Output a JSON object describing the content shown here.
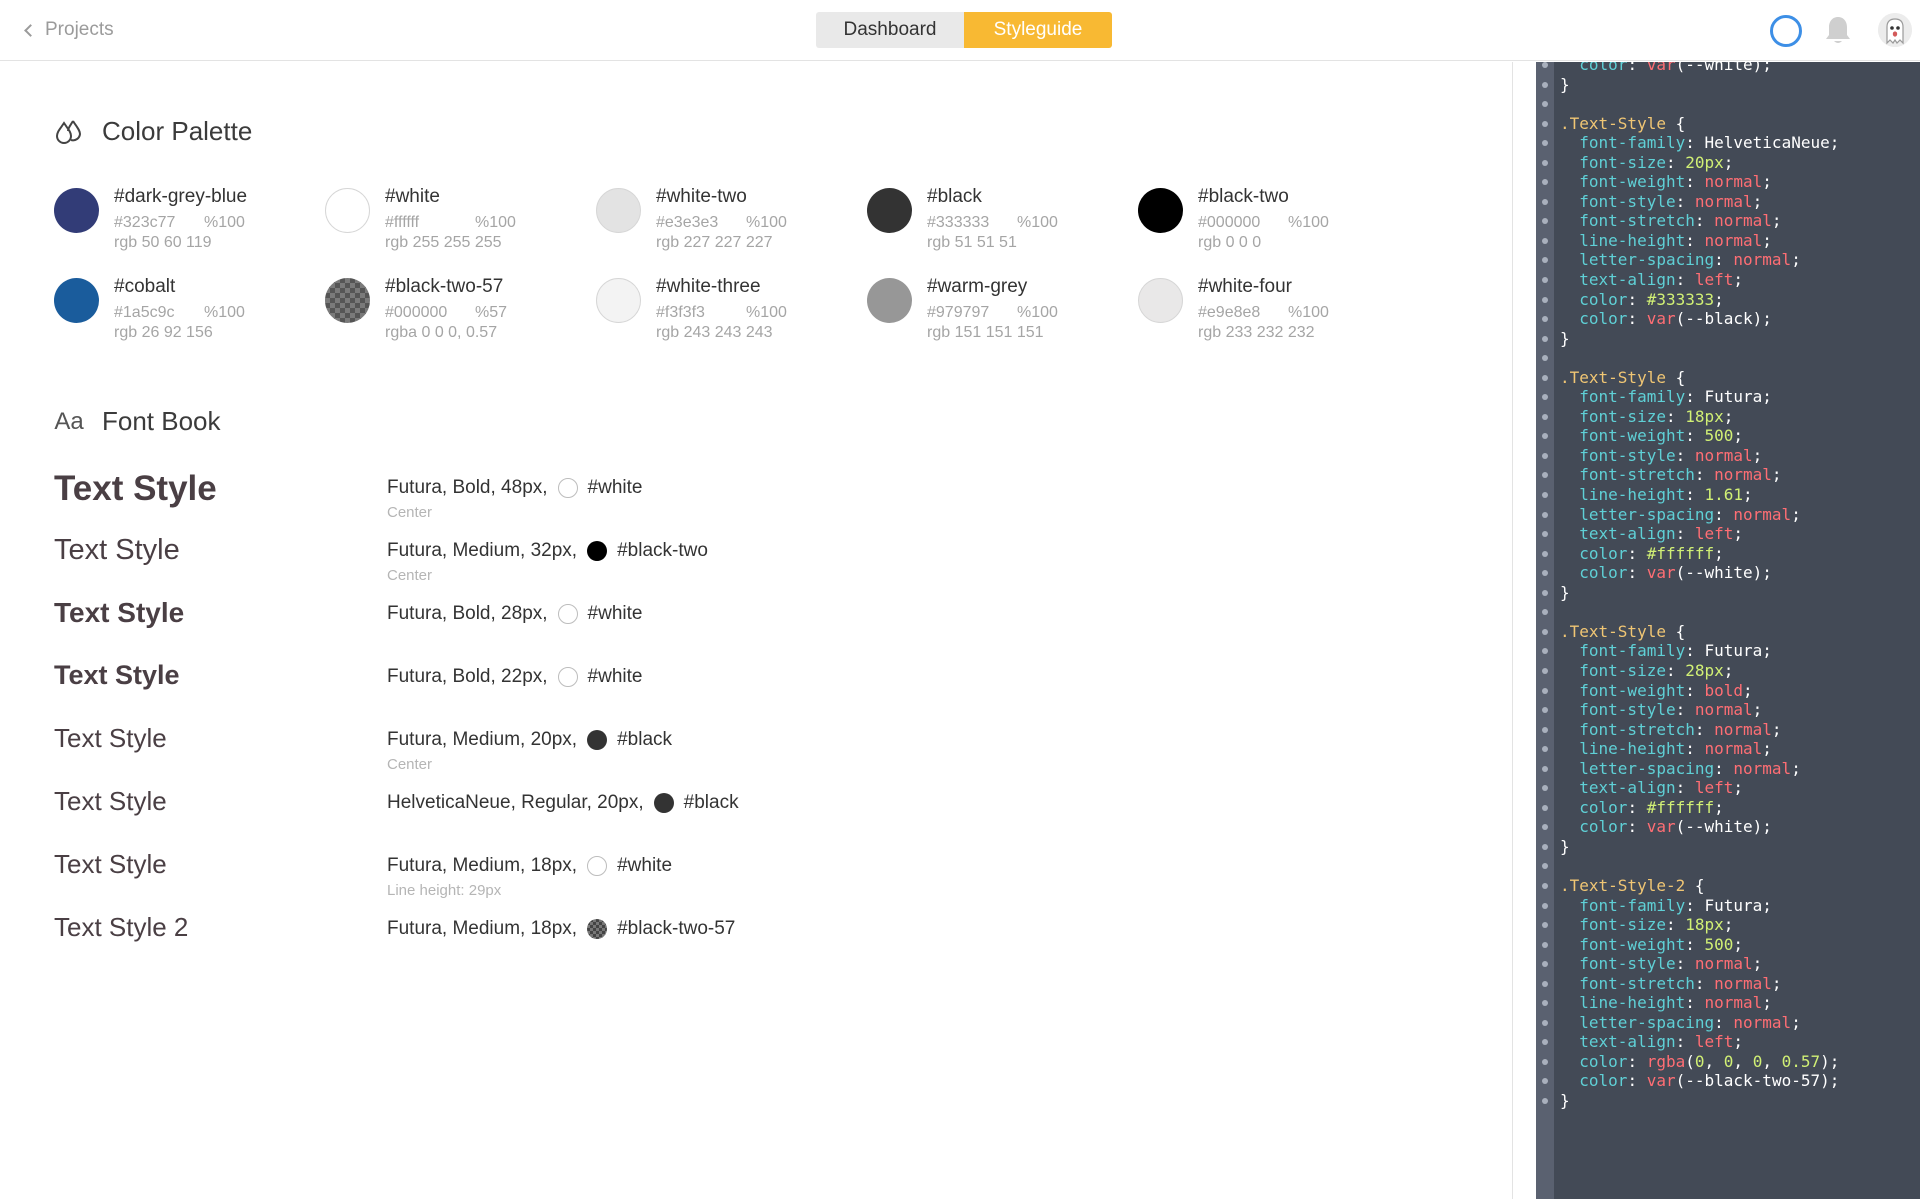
{
  "topbar": {
    "back_label": "Projects",
    "tabs": [
      {
        "label": "Dashboard",
        "active": false
      },
      {
        "label": "Styleguide",
        "active": true
      }
    ],
    "accent_color": "#f8b933",
    "status_color": "#3d8fe6"
  },
  "palette": {
    "title": "Color Palette",
    "colors": [
      {
        "name": "#dark-grey-blue",
        "hex": "#323c77",
        "opacity": "%100",
        "rgb": "rgb 50 60 119",
        "color": "#323c77"
      },
      {
        "name": "#white",
        "hex": "#ffffff",
        "opacity": "%100",
        "rgb": "rgb 255 255 255",
        "color": "#ffffff"
      },
      {
        "name": "#white-two",
        "hex": "#e3e3e3",
        "opacity": "%100",
        "rgb": "rgb 227 227 227",
        "color": "#e3e3e3"
      },
      {
        "name": "#black",
        "hex": "#333333",
        "opacity": "%100",
        "rgb": "rgb 51 51 51",
        "color": "#333333"
      },
      {
        "name": "#black-two",
        "hex": "#000000",
        "opacity": "%100",
        "rgb": "rgb 0 0 0",
        "color": "#000000"
      },
      {
        "name": "#cobalt",
        "hex": "#1a5c9c",
        "opacity": "%100",
        "rgb": "rgb 26 92 156",
        "color": "#1a5c9c"
      },
      {
        "name": "#black-two-57",
        "hex": "#000000",
        "opacity": "%57",
        "rgb": "rgba 0 0 0, 0.57",
        "color": "#6d6d6d"
      },
      {
        "name": "#white-three",
        "hex": "#f3f3f3",
        "opacity": "%100",
        "rgb": "rgb 243 243 243",
        "color": "#f3f3f3"
      },
      {
        "name": "#warm-grey",
        "hex": "#979797",
        "opacity": "%100",
        "rgb": "rgb 151 151 151",
        "color": "#979797"
      },
      {
        "name": "#white-four",
        "hex": "#e9e8e8",
        "opacity": "%100",
        "rgb": "rgb 233 232 232",
        "color": "#e9e8e8"
      }
    ]
  },
  "fontbook": {
    "title": "Font Book",
    "icon_text": "Aa",
    "styles": [
      {
        "sample": "Text Style",
        "desc": "Futura, Bold, 48px,",
        "color_name": "#white",
        "color": "#ffffff",
        "sub": "Center"
      },
      {
        "sample": "Text Style",
        "desc": "Futura, Medium, 32px,",
        "color_name": "#black-two",
        "color": "#000000",
        "sub": "Center"
      },
      {
        "sample": "Text Style",
        "desc": "Futura, Bold, 28px,",
        "color_name": "#white",
        "color": "#ffffff",
        "sub": ""
      },
      {
        "sample": "Text Style",
        "desc": "Futura, Bold, 22px,",
        "color_name": "#white",
        "color": "#ffffff",
        "sub": ""
      },
      {
        "sample": "Text Style",
        "desc": "Futura, Medium, 20px,",
        "color_name": "#black",
        "color": "#333333",
        "sub": "Center"
      },
      {
        "sample": "Text Style",
        "desc": "HelveticaNeue, Regular, 20px,",
        "color_name": "#black",
        "color": "#333333",
        "sub": ""
      },
      {
        "sample": "Text Style",
        "desc": "Futura, Medium, 18px,",
        "color_name": "#white",
        "color": "#ffffff",
        "sub": "Line height: 29px"
      },
      {
        "sample": "Text Style 2",
        "desc": "Futura, Medium, 18px,",
        "color_name": "#black-two-57",
        "color": "#6d6d6d",
        "sub": ""
      }
    ]
  },
  "code_lines": [
    [
      [
        "  ",
        "pun"
      ],
      [
        "color",
        "prop"
      ],
      [
        ": ",
        "pun"
      ],
      [
        "var",
        "fn"
      ],
      [
        "(--white);",
        "pun"
      ]
    ],
    [
      [
        "}",
        "pun"
      ]
    ],
    [
      [
        "",
        "pun"
      ]
    ],
    [
      [
        ".Text-Style",
        "sel"
      ],
      [
        " {",
        "pun"
      ]
    ],
    [
      [
        "  ",
        "pun"
      ],
      [
        "font-family",
        "prop"
      ],
      [
        ": HelveticaNeue;",
        "pun"
      ]
    ],
    [
      [
        "  ",
        "pun"
      ],
      [
        "font-size",
        "prop"
      ],
      [
        ": ",
        "pun"
      ],
      [
        "20px",
        "num"
      ],
      [
        ";",
        "pun"
      ]
    ],
    [
      [
        "  ",
        "pun"
      ],
      [
        "font-weight",
        "prop"
      ],
      [
        ": ",
        "pun"
      ],
      [
        "normal",
        "kw"
      ],
      [
        ";",
        "pun"
      ]
    ],
    [
      [
        "  ",
        "pun"
      ],
      [
        "font-style",
        "prop"
      ],
      [
        ": ",
        "pun"
      ],
      [
        "normal",
        "kw"
      ],
      [
        ";",
        "pun"
      ]
    ],
    [
      [
        "  ",
        "pun"
      ],
      [
        "font-stretch",
        "prop"
      ],
      [
        ": ",
        "pun"
      ],
      [
        "normal",
        "kw"
      ],
      [
        ";",
        "pun"
      ]
    ],
    [
      [
        "  ",
        "pun"
      ],
      [
        "line-height",
        "prop"
      ],
      [
        ": ",
        "pun"
      ],
      [
        "normal",
        "kw"
      ],
      [
        ";",
        "pun"
      ]
    ],
    [
      [
        "  ",
        "pun"
      ],
      [
        "letter-spacing",
        "prop"
      ],
      [
        ": ",
        "pun"
      ],
      [
        "normal",
        "kw"
      ],
      [
        ";",
        "pun"
      ]
    ],
    [
      [
        "  ",
        "pun"
      ],
      [
        "text-align",
        "prop"
      ],
      [
        ": ",
        "pun"
      ],
      [
        "left",
        "kw"
      ],
      [
        ";",
        "pun"
      ]
    ],
    [
      [
        "  ",
        "pun"
      ],
      [
        "color",
        "prop"
      ],
      [
        ": ",
        "pun"
      ],
      [
        "#333333",
        "num"
      ],
      [
        ";",
        "pun"
      ]
    ],
    [
      [
        "  ",
        "pun"
      ],
      [
        "color",
        "prop"
      ],
      [
        ": ",
        "pun"
      ],
      [
        "var",
        "fn"
      ],
      [
        "(--black);",
        "pun"
      ]
    ],
    [
      [
        "}",
        "pun"
      ]
    ],
    [
      [
        "",
        "pun"
      ]
    ],
    [
      [
        ".Text-Style",
        "sel"
      ],
      [
        " {",
        "pun"
      ]
    ],
    [
      [
        "  ",
        "pun"
      ],
      [
        "font-family",
        "prop"
      ],
      [
        ": Futura;",
        "pun"
      ]
    ],
    [
      [
        "  ",
        "pun"
      ],
      [
        "font-size",
        "prop"
      ],
      [
        ": ",
        "pun"
      ],
      [
        "18px",
        "num"
      ],
      [
        ";",
        "pun"
      ]
    ],
    [
      [
        "  ",
        "pun"
      ],
      [
        "font-weight",
        "prop"
      ],
      [
        ": ",
        "pun"
      ],
      [
        "500",
        "num"
      ],
      [
        ";",
        "pun"
      ]
    ],
    [
      [
        "  ",
        "pun"
      ],
      [
        "font-style",
        "prop"
      ],
      [
        ": ",
        "pun"
      ],
      [
        "normal",
        "kw"
      ],
      [
        ";",
        "pun"
      ]
    ],
    [
      [
        "  ",
        "pun"
      ],
      [
        "font-stretch",
        "prop"
      ],
      [
        ": ",
        "pun"
      ],
      [
        "normal",
        "kw"
      ],
      [
        ";",
        "pun"
      ]
    ],
    [
      [
        "  ",
        "pun"
      ],
      [
        "line-height",
        "prop"
      ],
      [
        ": ",
        "pun"
      ],
      [
        "1.61",
        "num"
      ],
      [
        ";",
        "pun"
      ]
    ],
    [
      [
        "  ",
        "pun"
      ],
      [
        "letter-spacing",
        "prop"
      ],
      [
        ": ",
        "pun"
      ],
      [
        "normal",
        "kw"
      ],
      [
        ";",
        "pun"
      ]
    ],
    [
      [
        "  ",
        "pun"
      ],
      [
        "text-align",
        "prop"
      ],
      [
        ": ",
        "pun"
      ],
      [
        "left",
        "kw"
      ],
      [
        ";",
        "pun"
      ]
    ],
    [
      [
        "  ",
        "pun"
      ],
      [
        "color",
        "prop"
      ],
      [
        ": ",
        "pun"
      ],
      [
        "#ffffff",
        "num"
      ],
      [
        ";",
        "pun"
      ]
    ],
    [
      [
        "  ",
        "pun"
      ],
      [
        "color",
        "prop"
      ],
      [
        ": ",
        "pun"
      ],
      [
        "var",
        "fn"
      ],
      [
        "(--white);",
        "pun"
      ]
    ],
    [
      [
        "}",
        "pun"
      ]
    ],
    [
      [
        "",
        "pun"
      ]
    ],
    [
      [
        ".Text-Style",
        "sel"
      ],
      [
        " {",
        "pun"
      ]
    ],
    [
      [
        "  ",
        "pun"
      ],
      [
        "font-family",
        "prop"
      ],
      [
        ": Futura;",
        "pun"
      ]
    ],
    [
      [
        "  ",
        "pun"
      ],
      [
        "font-size",
        "prop"
      ],
      [
        ": ",
        "pun"
      ],
      [
        "28px",
        "num"
      ],
      [
        ";",
        "pun"
      ]
    ],
    [
      [
        "  ",
        "pun"
      ],
      [
        "font-weight",
        "prop"
      ],
      [
        ": ",
        "pun"
      ],
      [
        "bold",
        "kw"
      ],
      [
        ";",
        "pun"
      ]
    ],
    [
      [
        "  ",
        "pun"
      ],
      [
        "font-style",
        "prop"
      ],
      [
        ": ",
        "pun"
      ],
      [
        "normal",
        "kw"
      ],
      [
        ";",
        "pun"
      ]
    ],
    [
      [
        "  ",
        "pun"
      ],
      [
        "font-stretch",
        "prop"
      ],
      [
        ": ",
        "pun"
      ],
      [
        "normal",
        "kw"
      ],
      [
        ";",
        "pun"
      ]
    ],
    [
      [
        "  ",
        "pun"
      ],
      [
        "line-height",
        "prop"
      ],
      [
        ": ",
        "pun"
      ],
      [
        "normal",
        "kw"
      ],
      [
        ";",
        "pun"
      ]
    ],
    [
      [
        "  ",
        "pun"
      ],
      [
        "letter-spacing",
        "prop"
      ],
      [
        ": ",
        "pun"
      ],
      [
        "normal",
        "kw"
      ],
      [
        ";",
        "pun"
      ]
    ],
    [
      [
        "  ",
        "pun"
      ],
      [
        "text-align",
        "prop"
      ],
      [
        ": ",
        "pun"
      ],
      [
        "left",
        "kw"
      ],
      [
        ";",
        "pun"
      ]
    ],
    [
      [
        "  ",
        "pun"
      ],
      [
        "color",
        "prop"
      ],
      [
        ": ",
        "pun"
      ],
      [
        "#ffffff",
        "num"
      ],
      [
        ";",
        "pun"
      ]
    ],
    [
      [
        "  ",
        "pun"
      ],
      [
        "color",
        "prop"
      ],
      [
        ": ",
        "pun"
      ],
      [
        "var",
        "fn"
      ],
      [
        "(--white);",
        "pun"
      ]
    ],
    [
      [
        "}",
        "pun"
      ]
    ],
    [
      [
        "",
        "pun"
      ]
    ],
    [
      [
        ".Text-Style-2",
        "sel"
      ],
      [
        " {",
        "pun"
      ]
    ],
    [
      [
        "  ",
        "pun"
      ],
      [
        "font-family",
        "prop"
      ],
      [
        ": Futura;",
        "pun"
      ]
    ],
    [
      [
        "  ",
        "pun"
      ],
      [
        "font-size",
        "prop"
      ],
      [
        ": ",
        "pun"
      ],
      [
        "18px",
        "num"
      ],
      [
        ";",
        "pun"
      ]
    ],
    [
      [
        "  ",
        "pun"
      ],
      [
        "font-weight",
        "prop"
      ],
      [
        ": ",
        "pun"
      ],
      [
        "500",
        "num"
      ],
      [
        ";",
        "pun"
      ]
    ],
    [
      [
        "  ",
        "pun"
      ],
      [
        "font-style",
        "prop"
      ],
      [
        ": ",
        "pun"
      ],
      [
        "normal",
        "kw"
      ],
      [
        ";",
        "pun"
      ]
    ],
    [
      [
        "  ",
        "pun"
      ],
      [
        "font-stretch",
        "prop"
      ],
      [
        ": ",
        "pun"
      ],
      [
        "normal",
        "kw"
      ],
      [
        ";",
        "pun"
      ]
    ],
    [
      [
        "  ",
        "pun"
      ],
      [
        "line-height",
        "prop"
      ],
      [
        ": ",
        "pun"
      ],
      [
        "normal",
        "kw"
      ],
      [
        ";",
        "pun"
      ]
    ],
    [
      [
        "  ",
        "pun"
      ],
      [
        "letter-spacing",
        "prop"
      ],
      [
        ": ",
        "pun"
      ],
      [
        "normal",
        "kw"
      ],
      [
        ";",
        "pun"
      ]
    ],
    [
      [
        "  ",
        "pun"
      ],
      [
        "text-align",
        "prop"
      ],
      [
        ": ",
        "pun"
      ],
      [
        "left",
        "kw"
      ],
      [
        ";",
        "pun"
      ]
    ],
    [
      [
        "  ",
        "pun"
      ],
      [
        "color",
        "prop"
      ],
      [
        ": ",
        "pun"
      ],
      [
        "rgba",
        "fn"
      ],
      [
        "(",
        "pun"
      ],
      [
        "0",
        "num"
      ],
      [
        ", ",
        "pun"
      ],
      [
        "0",
        "num"
      ],
      [
        ", ",
        "pun"
      ],
      [
        "0",
        "num"
      ],
      [
        ", ",
        "pun"
      ],
      [
        "0.57",
        "num"
      ],
      [
        ");",
        "pun"
      ]
    ],
    [
      [
        "  ",
        "pun"
      ],
      [
        "color",
        "prop"
      ],
      [
        ": ",
        "pun"
      ],
      [
        "var",
        "fn"
      ],
      [
        "(--black-two-57);",
        "pun"
      ]
    ],
    [
      [
        "}",
        "pun"
      ]
    ]
  ]
}
